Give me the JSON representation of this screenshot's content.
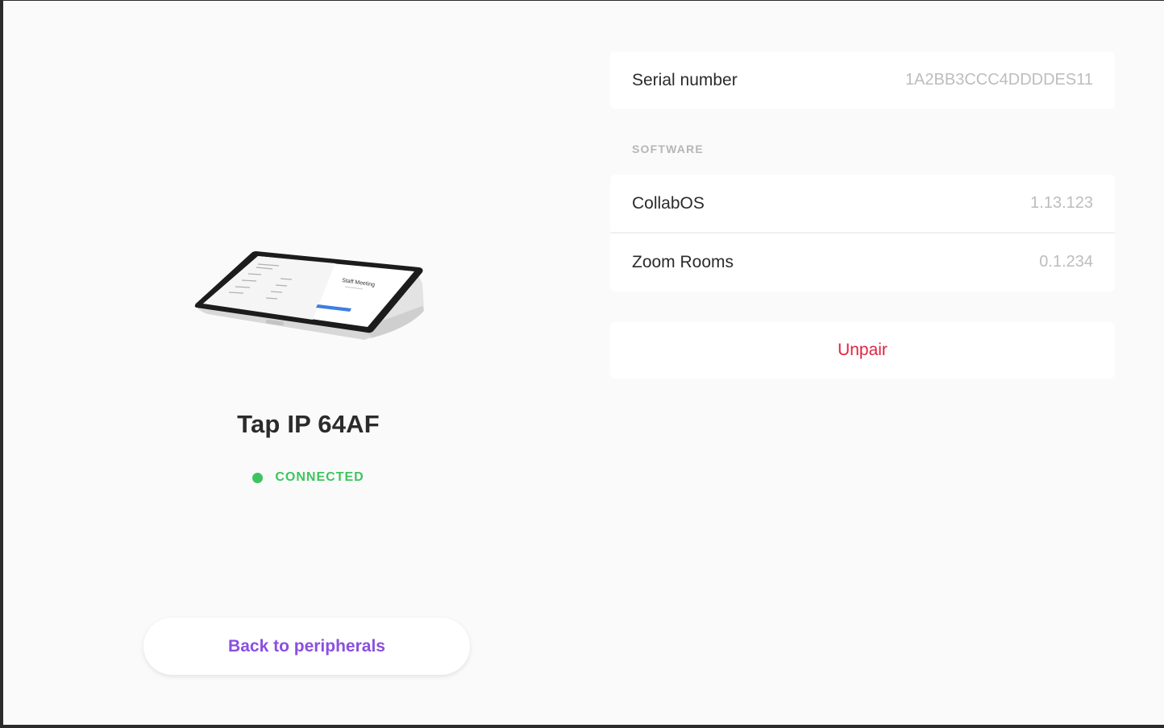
{
  "device": {
    "name": "Tap IP 64AF",
    "status": "CONNECTED",
    "status_color": "#3ec45e",
    "image_icon": "touch-controller-icon",
    "screen_text": {
      "meeting_title": "Staff Meeting"
    }
  },
  "details": {
    "serial_label": "Serial number",
    "serial_value": "1A2BB3CCC4DDDDES11"
  },
  "software": {
    "header": "SOFTWARE",
    "items": [
      {
        "label": "CollabOS",
        "value": "1.13.123"
      },
      {
        "label": "Zoom Rooms",
        "value": "0.1.234"
      }
    ]
  },
  "actions": {
    "unpair_label": "Unpair",
    "unpair_color": "#e0243f",
    "back_label": "Back to peripherals",
    "back_color": "#8a4fe0"
  }
}
